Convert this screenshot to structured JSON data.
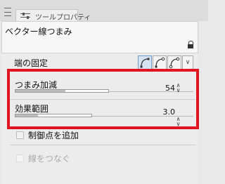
{
  "panel": {
    "tab_label": "ツールプロパティ",
    "tool_name": "ベクター線つまみ"
  },
  "properties": {
    "pin_end": {
      "label": "端の固定",
      "options": [
        "pin-both-ends-icon",
        "pin-one-end-icon",
        "free-ends-icon"
      ],
      "selected_index": 0
    },
    "pinch_adjust": {
      "label": "つまみ加減",
      "value": "54",
      "fraction": 0.54
    },
    "effect_range": {
      "label": "効果範囲",
      "value": "3.0",
      "fraction": 0.3
    },
    "add_control_point": {
      "label": "制御点を追加",
      "checked": false
    },
    "connect_lines": {
      "label": "線をつなぐ",
      "checked": false,
      "disabled": true
    }
  },
  "colors": {
    "highlight_border": "#e01423",
    "background": "#e9e9e9"
  }
}
